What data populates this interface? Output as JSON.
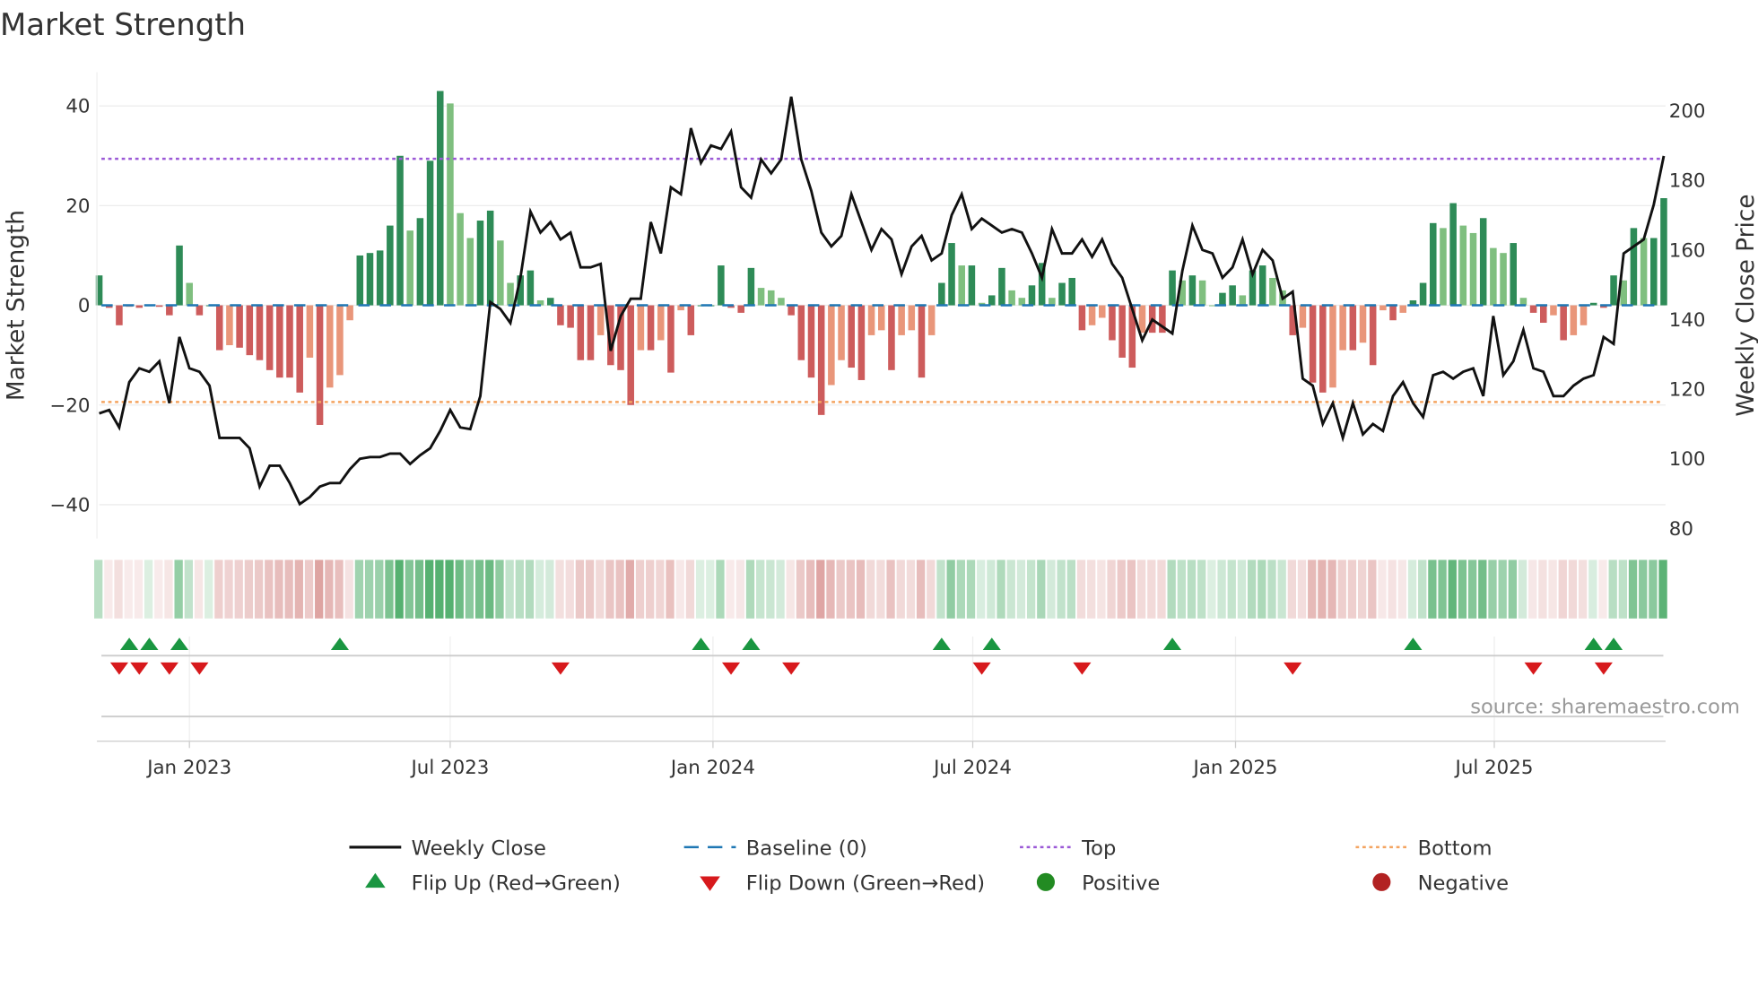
{
  "chart_data": {
    "type": "bar",
    "title": "Market Strength",
    "ylabel": "Market Strength",
    "y2label": "Weekly Close Price",
    "ylim": [
      -46,
      46
    ],
    "y2lim": [
      76,
      206
    ],
    "yticks": [
      40,
      20,
      0,
      -20,
      -40
    ],
    "yticks_labels": [
      "40",
      "20",
      "0",
      "−20",
      "−40"
    ],
    "y2ticks": [
      200,
      180,
      160,
      140,
      120,
      100,
      80
    ],
    "y2ticks_labels": [
      "200",
      "180",
      "160",
      "140",
      "120",
      "100",
      "80"
    ],
    "interval": "weekly",
    "start_week": "2022-10-30",
    "xticks": [
      {
        "week": 9,
        "label": "Jan 2023"
      },
      {
        "week": 35,
        "label": "Jul 2023"
      },
      {
        "week": 61.2,
        "label": "Jan 2024"
      },
      {
        "week": 87.1,
        "label": "Jul 2024"
      },
      {
        "week": 113.3,
        "label": "Jan 2025"
      },
      {
        "week": 139.1,
        "label": "Jul 2025"
      }
    ],
    "top_level": 29.4,
    "bottom_level": -19.4,
    "baseline": 0,
    "strength": [
      6,
      -0.5,
      -4,
      -0.3,
      -0.5,
      0,
      -0.3,
      -2,
      12,
      4.5,
      -2,
      0,
      -9,
      -8,
      -8.5,
      -10,
      -11,
      -13,
      -14.5,
      -14.5,
      -17.5,
      -10.5,
      -24,
      -16.5,
      -14,
      -3,
      10,
      10.5,
      11,
      16,
      30,
      15,
      17.5,
      29,
      43,
      40.5,
      18.5,
      13.5,
      17,
      19,
      13,
      4.5,
      6,
      7,
      1,
      1.5,
      -4,
      -4.5,
      -11,
      -11,
      -6,
      -12,
      -13,
      -20,
      -9,
      -9,
      -7,
      -13.5,
      -1,
      -6,
      0,
      0,
      8,
      -0.5,
      -1.5,
      7.5,
      3.5,
      3,
      1.5,
      -2,
      -11,
      -14.5,
      -22,
      -16,
      -11,
      -12.5,
      -15,
      -6,
      -5,
      -13,
      -6,
      -5,
      -14.5,
      -6,
      4.5,
      12.5,
      8,
      8,
      0.5,
      2,
      7.5,
      3,
      1.5,
      4,
      8.5,
      1.5,
      4.5,
      5.5,
      -5,
      -4,
      -2.5,
      -7,
      -10.5,
      -12.5,
      -5.5,
      -5.5,
      -5.5,
      7,
      5,
      6,
      5,
      0,
      2.5,
      4,
      2,
      7,
      8,
      5.5,
      3,
      -6,
      -4.5,
      -15.5,
      -17.5,
      -16.5,
      -9,
      -9,
      -7.5,
      -12,
      -1,
      -3,
      -1.5,
      1,
      4.5,
      16.5,
      15.5,
      20.5,
      16,
      14.5,
      17.5,
      11.5,
      10.5,
      12.5,
      1.5,
      -1.5,
      -3.5,
      -2,
      -7,
      -6,
      -4,
      0.5,
      -0.5,
      6,
      5,
      15.5,
      13.5,
      13.5,
      21.5
    ],
    "weekly_close": [
      113,
      114,
      109,
      122,
      126,
      125,
      128,
      116,
      135,
      126,
      125,
      121,
      106,
      106,
      106,
      103,
      92,
      98,
      98,
      93,
      87,
      89,
      92,
      93,
      93,
      97,
      100,
      100.5,
      100.5,
      101.5,
      101.5,
      98.5,
      101,
      103,
      108,
      114,
      109,
      108.5,
      118,
      145,
      143,
      139,
      152,
      171,
      165,
      168,
      163,
      165,
      155,
      155,
      156,
      131,
      141,
      146,
      146,
      168,
      159,
      178,
      176,
      195,
      185,
      190,
      189,
      194,
      178,
      175,
      186,
      182,
      186,
      204,
      186,
      177,
      165,
      161,
      164,
      176,
      168,
      160,
      166,
      163,
      153,
      161,
      164,
      157,
      159,
      170,
      176,
      166,
      169,
      167,
      165,
      166,
      165,
      159,
      152,
      166,
      159,
      159,
      163,
      158,
      163,
      156,
      152,
      143,
      134,
      140,
      138,
      136,
      154,
      167,
      160,
      159,
      152,
      155,
      163,
      153,
      160,
      157,
      146,
      148,
      123,
      121,
      110,
      116,
      106,
      116,
      107,
      110,
      108,
      118,
      122,
      116,
      112,
      124,
      125,
      123,
      125,
      126,
      118,
      141,
      124,
      128,
      137,
      126,
      125,
      118,
      118,
      121,
      123,
      124,
      135,
      133,
      159,
      161,
      163,
      173,
      187
    ],
    "flip_up_weeks": [
      3,
      5,
      8,
      24,
      60,
      65,
      84,
      89,
      107,
      131,
      149,
      151
    ],
    "flip_down_weeks": [
      2,
      4,
      7,
      10,
      46,
      63,
      69,
      88,
      98,
      119,
      143,
      150
    ],
    "colors": {
      "pos_strong": "#2e8b57",
      "pos_weak": "#7fbf7f",
      "neg_strong": "#cd5c5c",
      "neg_weak": "#e9967a",
      "close": "#111111",
      "baseline": "#1f77b4",
      "top": "#9b59d6",
      "bottom": "#f4a460",
      "flip_up": "#1a9641",
      "flip_down": "#d7191c",
      "positive": "#228b22",
      "negative": "#b22222"
    },
    "legend": [
      {
        "label": "Weekly Close",
        "kind": "line"
      },
      {
        "label": "Baseline (0)",
        "kind": "dash"
      },
      {
        "label": "Top",
        "kind": "dot-purple"
      },
      {
        "label": "Bottom",
        "kind": "dot-orange"
      },
      {
        "label": "Flip Up (Red→Green)",
        "kind": "tri-up"
      },
      {
        "label": "Flip Down (Green→Red)",
        "kind": "tri-down"
      },
      {
        "label": "Positive",
        "kind": "circle-green"
      },
      {
        "label": "Negative",
        "kind": "circle-red"
      }
    ],
    "legend_position": "bottom",
    "source": "source: sharemaestro.com"
  }
}
